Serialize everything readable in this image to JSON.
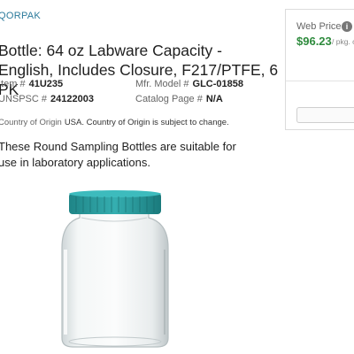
{
  "product": {
    "brand": "QORPAK",
    "title": "Bottle: 64 oz Labware Capacity - English, Includes Closure, F217/PTFE, 6 PK",
    "specs": {
      "item_label": "Item #",
      "item_value": "41U235",
      "mfr_label": "Mfr. Model #",
      "mfr_value": "GLC-01858",
      "unspsc_label": "UNSPSC #",
      "unspsc_value": "24122003",
      "catalog_label": "Catalog Page #",
      "catalog_value": "N/A"
    },
    "origin_label": "Country of Origin",
    "origin_value": "USA. Country of Origin is subject to change.",
    "description": "These Round Sampling Bottles are suitable for use in laboratory applications."
  },
  "pricing": {
    "label": "Web Price",
    "info_icon": "i",
    "price": "$96.23",
    "unit": "/ pkg. o"
  },
  "colors": {
    "brand_link": "#2b7a9b",
    "price_green": "#2e8b3d",
    "cap_teal": "#2a9a9c"
  },
  "image": {
    "subject": "product-photo-glass-bottle-with-teal-cap"
  }
}
